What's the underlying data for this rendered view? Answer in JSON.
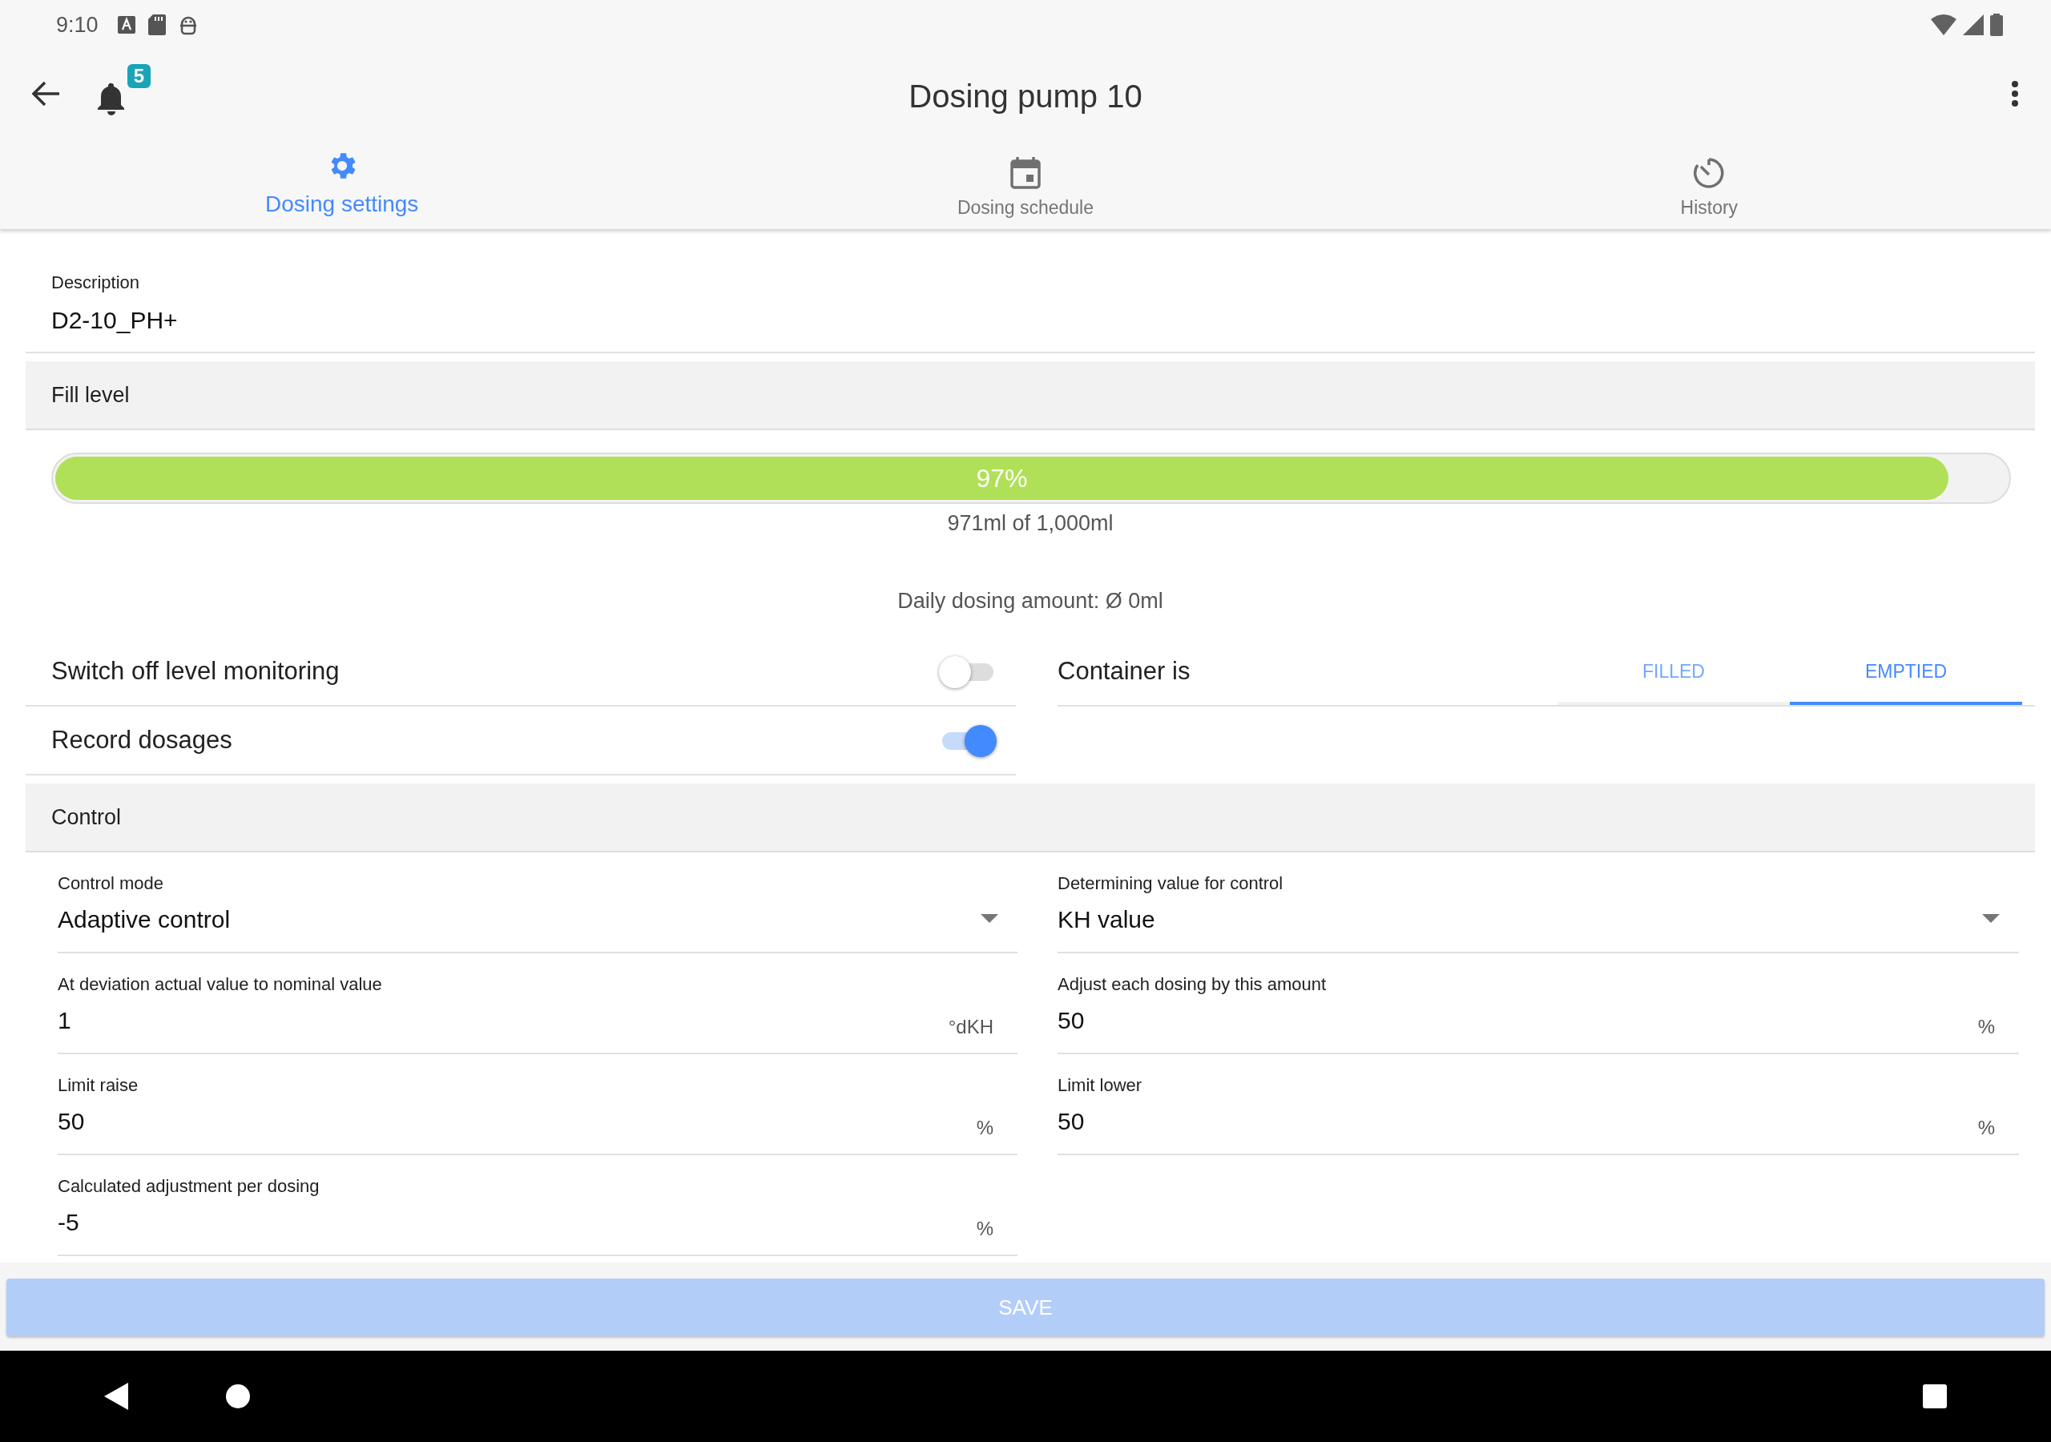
{
  "status_bar": {
    "time": "9:10"
  },
  "app_bar": {
    "title": "Dosing pump 10",
    "notification_count": "5"
  },
  "tabs": [
    {
      "label": "Dosing settings",
      "selected": true,
      "kind": "settings"
    },
    {
      "label": "Dosing schedule",
      "selected": false,
      "kind": "schedule"
    },
    {
      "label": "History",
      "selected": false,
      "kind": "history"
    }
  ],
  "description": {
    "label": "Description",
    "value": "D2-10_PH+"
  },
  "fill_level": {
    "header": "Fill level",
    "level": 0.97,
    "reading": "97%",
    "amount": "971ml of 1,000ml",
    "daily": "Daily dosing amount: Ø 0ml"
  },
  "switches": [
    {
      "label": "Switch off level monitoring",
      "on": false
    },
    {
      "label": "Record dosages",
      "on": true
    }
  ],
  "container": {
    "label": "Container is",
    "options": [
      {
        "label": "FILLED",
        "selected": false
      },
      {
        "label": "EMPTIED",
        "selected": true
      }
    ]
  },
  "control": {
    "header": "Control",
    "fields": [
      {
        "kind": "select",
        "label": "Control mode",
        "value": "Adaptive control"
      },
      {
        "kind": "select",
        "label": "Determining value for control",
        "value": "KH value"
      },
      {
        "kind": "input",
        "label": "At deviation actual value to nominal value",
        "value": "1",
        "unit": "°dKH"
      },
      {
        "kind": "input",
        "label": "Adjust each dosing by this amount",
        "value": "50",
        "unit": "%"
      },
      {
        "kind": "input",
        "label": "Limit raise",
        "value": "50",
        "unit": "%"
      },
      {
        "kind": "input",
        "label": "Limit lower",
        "value": "50",
        "unit": "%"
      },
      {
        "kind": "input",
        "label": "Calculated adjustment per dosing",
        "value": "-5",
        "unit": "%"
      }
    ]
  },
  "save": {
    "label": "SAVE",
    "disabled": true
  }
}
